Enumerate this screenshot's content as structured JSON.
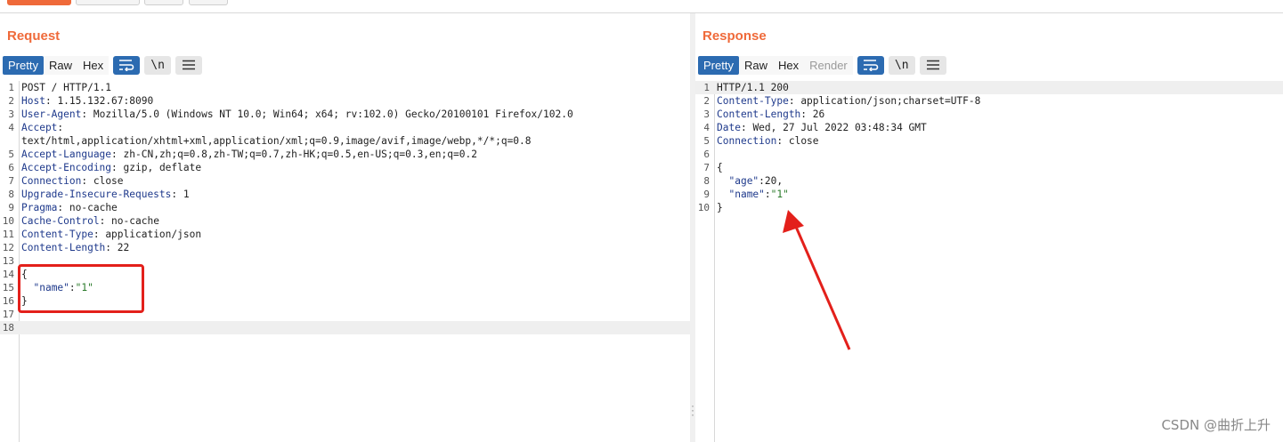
{
  "request": {
    "title": "Request",
    "tabs": [
      "Pretty",
      "Raw",
      "Hex"
    ],
    "newline_label": "\\n",
    "lines": [
      {
        "n": "1",
        "k": "",
        "v": "POST / HTTP/1.1"
      },
      {
        "n": "2",
        "k": "Host",
        "v": " 1.15.132.67:8090"
      },
      {
        "n": "3",
        "k": "User-Agent",
        "v": " Mozilla/5.0 (Windows NT 10.0; Win64; x64; rv:102.0) Gecko/20100101 Firefox/102.0"
      },
      {
        "n": "4",
        "k": "Accept",
        "v": ""
      },
      {
        "n": "",
        "k": "",
        "v": "text/html,application/xhtml+xml,application/xml;q=0.9,image/avif,image/webp,*/*;q=0.8"
      },
      {
        "n": "5",
        "k": "Accept-Language",
        "v": " zh-CN,zh;q=0.8,zh-TW;q=0.7,zh-HK;q=0.5,en-US;q=0.3,en;q=0.2"
      },
      {
        "n": "6",
        "k": "Accept-Encoding",
        "v": " gzip, deflate"
      },
      {
        "n": "7",
        "k": "Connection",
        "v": " close"
      },
      {
        "n": "8",
        "k": "Upgrade-Insecure-Requests",
        "v": " 1"
      },
      {
        "n": "9",
        "k": "Pragma",
        "v": " no-cache"
      },
      {
        "n": "10",
        "k": "Cache-Control",
        "v": " no-cache"
      },
      {
        "n": "11",
        "k": "Content-Type",
        "v": " application/json"
      },
      {
        "n": "12",
        "k": "Content-Length",
        "v": " 22"
      },
      {
        "n": "13",
        "k": "",
        "v": ""
      },
      {
        "n": "14",
        "k": "",
        "v": "{"
      },
      {
        "n": "15",
        "k": "",
        "v": "",
        "jkey": "\"name\"",
        "jval": "\"1\"",
        "jtype": "s"
      },
      {
        "n": "16",
        "k": "",
        "v": "}"
      },
      {
        "n": "17",
        "k": "",
        "v": ""
      },
      {
        "n": "18",
        "k": "",
        "v": "",
        "hl": true
      }
    ]
  },
  "response": {
    "title": "Response",
    "tabs": [
      "Pretty",
      "Raw",
      "Hex",
      "Render"
    ],
    "newline_label": "\\n",
    "lines": [
      {
        "n": "1",
        "k": "",
        "v": "HTTP/1.1 200",
        "hl": true
      },
      {
        "n": "2",
        "k": "Content-Type",
        "v": " application/json;charset=UTF-8"
      },
      {
        "n": "3",
        "k": "Content-Length",
        "v": " 26"
      },
      {
        "n": "4",
        "k": "Date",
        "v": " Wed, 27 Jul 2022 03:48:34 GMT"
      },
      {
        "n": "5",
        "k": "Connection",
        "v": " close"
      },
      {
        "n": "6",
        "k": "",
        "v": ""
      },
      {
        "n": "7",
        "k": "",
        "v": "{"
      },
      {
        "n": "8",
        "k": "",
        "v": "",
        "jkey": "\"age\"",
        "jval": "20",
        "jtype": "n",
        "trail": ","
      },
      {
        "n": "9",
        "k": "",
        "v": "",
        "jkey": "\"name\"",
        "jval": "\"1\"",
        "jtype": "s"
      },
      {
        "n": "10",
        "k": "",
        "v": "}"
      }
    ]
  },
  "watermark": "CSDN @曲折上升",
  "colors": {
    "accent": "#ef6a3a",
    "active_tab": "#2c6bb1",
    "annotation": "#e3201b"
  }
}
